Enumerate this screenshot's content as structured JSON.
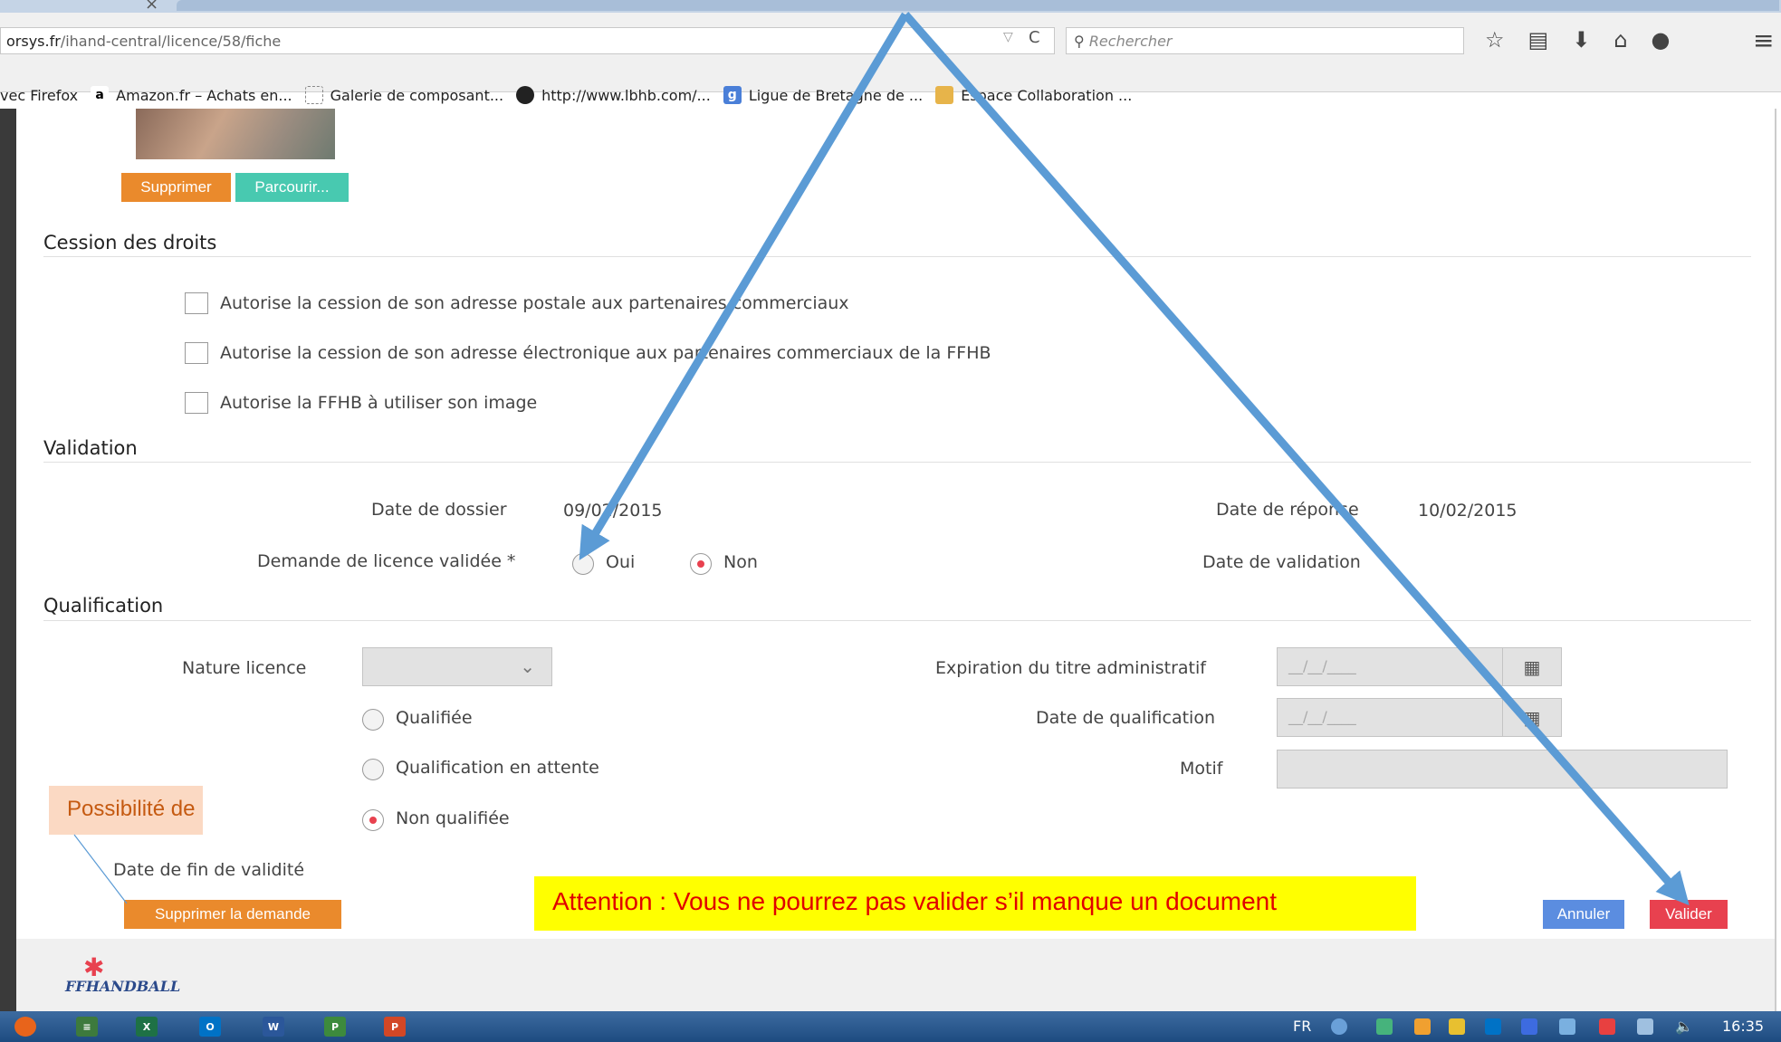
{
  "browser": {
    "url_prefix": "orsys.fr",
    "url_rest": "/ihand-central/licence/58/fiche",
    "search_placeholder": "Rechercher",
    "bookmarks": [
      {
        "label": "vec Firefox",
        "icon": "none"
      },
      {
        "label": "Amazon.fr – Achats en...",
        "icon": "amazon-icon"
      },
      {
        "label": "Galerie de composant...",
        "icon": "page-icon"
      },
      {
        "label": "http://www.lbhb.com/...",
        "icon": "lbhb-icon"
      },
      {
        "label": "Ligue de Bretagne de ...",
        "icon": "google-icon"
      },
      {
        "label": "Espace Collaboration ...",
        "icon": "collab-icon"
      }
    ]
  },
  "photo_buttons": {
    "delete_label": "Supprimer",
    "browse_label": "Parcourir..."
  },
  "cession": {
    "title": "Cession des droits",
    "options": [
      "Autorise la cession de son adresse postale aux partenaires commerciaux",
      "Autorise la cession de son adresse électronique aux partenaires commerciaux de la FFHB",
      "Autorise la FFHB à utiliser son image"
    ]
  },
  "validation": {
    "title": "Validation",
    "date_dossier_label": "Date de dossier",
    "date_dossier_value": "09/02/2015",
    "date_reponse_label": "Date de réponse",
    "date_reponse_value": "10/02/2015",
    "demande_label": "Demande de licence validée *",
    "oui_label": "Oui",
    "non_label": "Non",
    "selected": "Non",
    "date_validation_label": "Date de validation"
  },
  "qualification": {
    "title": "Qualification",
    "nature_label": "Nature licence",
    "nature_value": "",
    "options": [
      "Qualifiée",
      "Qualification en attente",
      "Non qualifiée"
    ],
    "selected": "Non qualifiée",
    "expiration_label": "Expiration du titre administratif",
    "expiration_value": "__/__/____",
    "date_qualif_label": "Date de qualification",
    "date_qualif_value": "__/__/____",
    "motif_label": "Motif",
    "motif_value": "",
    "date_fin_label": "Date de fin de validité"
  },
  "actions": {
    "delete_request_label": "Supprimer la demande",
    "cancel_label": "Annuler",
    "validate_label": "Valider"
  },
  "annotations": {
    "callout": "Possibilité de",
    "warning": "Attention :  Vous ne pourrez pas valider s’il manque un document"
  },
  "footer": {
    "logo_text": "HANDBALL",
    "logo_prefix": "FF"
  },
  "taskbar": {
    "language": "FR",
    "time": "16:35"
  },
  "colors": {
    "orange": "#ea8a2c",
    "teal": "#48c9b0",
    "blue": "#5b8de0",
    "red": "#e8414f",
    "arrow": "#5b9bd5",
    "warning_bg": "#ffff00"
  }
}
